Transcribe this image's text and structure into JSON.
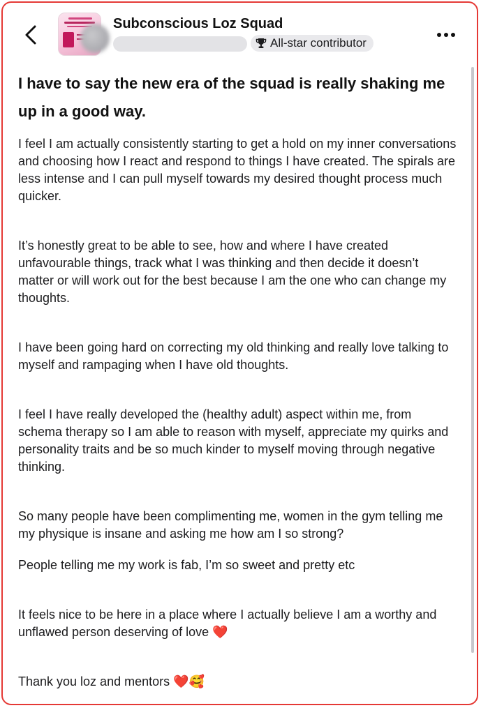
{
  "header": {
    "group_name": "Subconscious Loz Squad",
    "badge_label": "All-star contributor",
    "icons": {
      "back": "chevron-left-icon",
      "badge": "trophy-icon",
      "more": "more-horizontal-icon"
    }
  },
  "post": {
    "title": "I have to say the new era of the squad is really shaking me up in a good way.",
    "paragraphs": [
      "I feel I am actually consistently starting to get a hold on my inner conversations and choosing how I react and respond to things I have created. The spirals are less intense and I can pull myself towards my desired thought process much quicker.",
      "It’s honestly great to be able to see, how and where I have created unfavourable things, track what I was thinking and then decide it doesn’t matter or will work out for the best because I am the one who can change my thoughts.",
      "I have been going hard on correcting my old thinking and really love talking to myself and rampaging when I have old thoughts.",
      "I feel I have really developed the (healthy adult) aspect within me, from schema therapy so I am able to reason with myself, appreciate my quirks and personality traits and be so much kinder to myself moving through negative thinking.",
      "So many people have been complimenting me, women in the gym telling me my physique is insane and asking me how am I so strong?",
      "People telling me my work is fab, I’m so sweet and pretty etc",
      "It feels nice to be here in a place where I actually believe I am a worthy and unflawed person deserving of love ❤️",
      "Thank you loz and mentors ❤️🥰"
    ]
  },
  "colors": {
    "frame_border": "#e53935",
    "badge_bg": "#e9e9ec",
    "text": "#1c1c1e"
  }
}
